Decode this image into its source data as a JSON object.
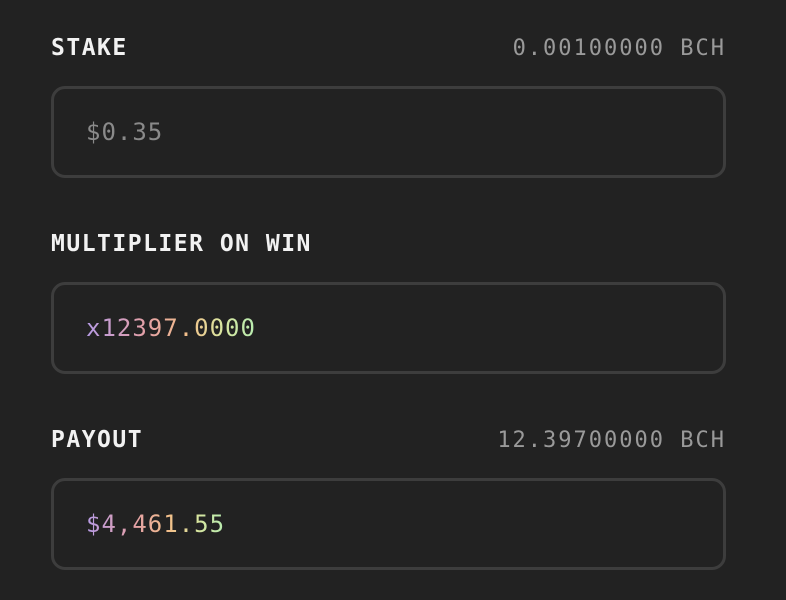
{
  "stake": {
    "label": "STAKE",
    "crypto_amount": "0.00100000 BCH",
    "value": "$0.35"
  },
  "multiplier": {
    "label": "MULTIPLIER ON WIN",
    "value": "x12397.0000"
  },
  "payout": {
    "label": "PAYOUT",
    "crypto_amount": "12.39700000 BCH",
    "value": "$4,461.55"
  },
  "colors": {
    "background": "#222222",
    "border": "#3d3d3d",
    "gradient": [
      "#b79be6",
      "#e4a0a6",
      "#f3c08a",
      "#b7ecb0"
    ]
  }
}
